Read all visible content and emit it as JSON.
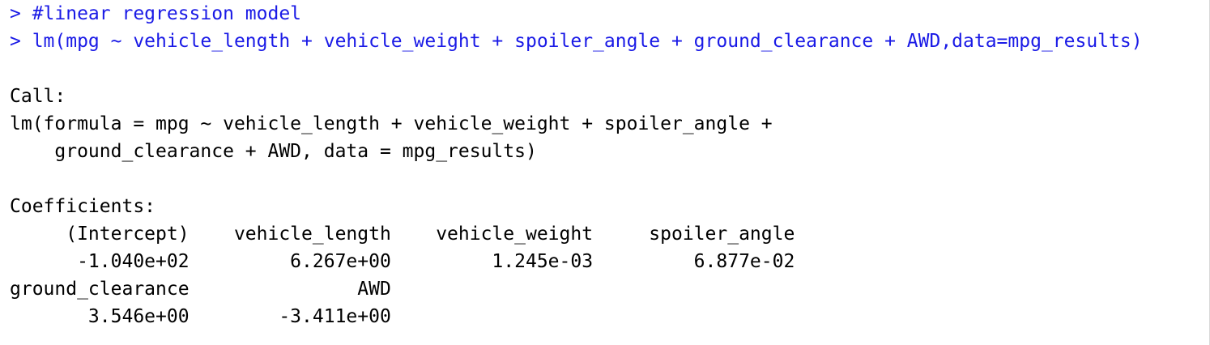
{
  "console": {
    "lines": [
      {
        "kind": "input",
        "text": "> #linear regression model"
      },
      {
        "kind": "input",
        "text": "> lm(mpg ~ vehicle_length + vehicle_weight + spoiler_angle + ground_clearance + AWD,data=mpg_results)"
      },
      {
        "kind": "blank",
        "text": ""
      },
      {
        "kind": "output",
        "text": "Call:"
      },
      {
        "kind": "output",
        "text": "lm(formula = mpg ~ vehicle_length + vehicle_weight + spoiler_angle + "
      },
      {
        "kind": "output",
        "text": "    ground_clearance + AWD, data = mpg_results)"
      },
      {
        "kind": "blank",
        "text": ""
      },
      {
        "kind": "output",
        "text": "Coefficients:"
      },
      {
        "kind": "output",
        "text": "     (Intercept)    vehicle_length    vehicle_weight     spoiler_angle  "
      },
      {
        "kind": "output",
        "text": "      -1.040e+02         6.267e+00         1.245e-03         6.877e-02  "
      },
      {
        "kind": "output",
        "text": "ground_clearance               AWD  "
      },
      {
        "kind": "output",
        "text": "       3.546e+00        -3.411e+00  "
      }
    ]
  },
  "colors": {
    "input": "#1a1ae6",
    "output": "#000000",
    "background": "#ffffff"
  }
}
